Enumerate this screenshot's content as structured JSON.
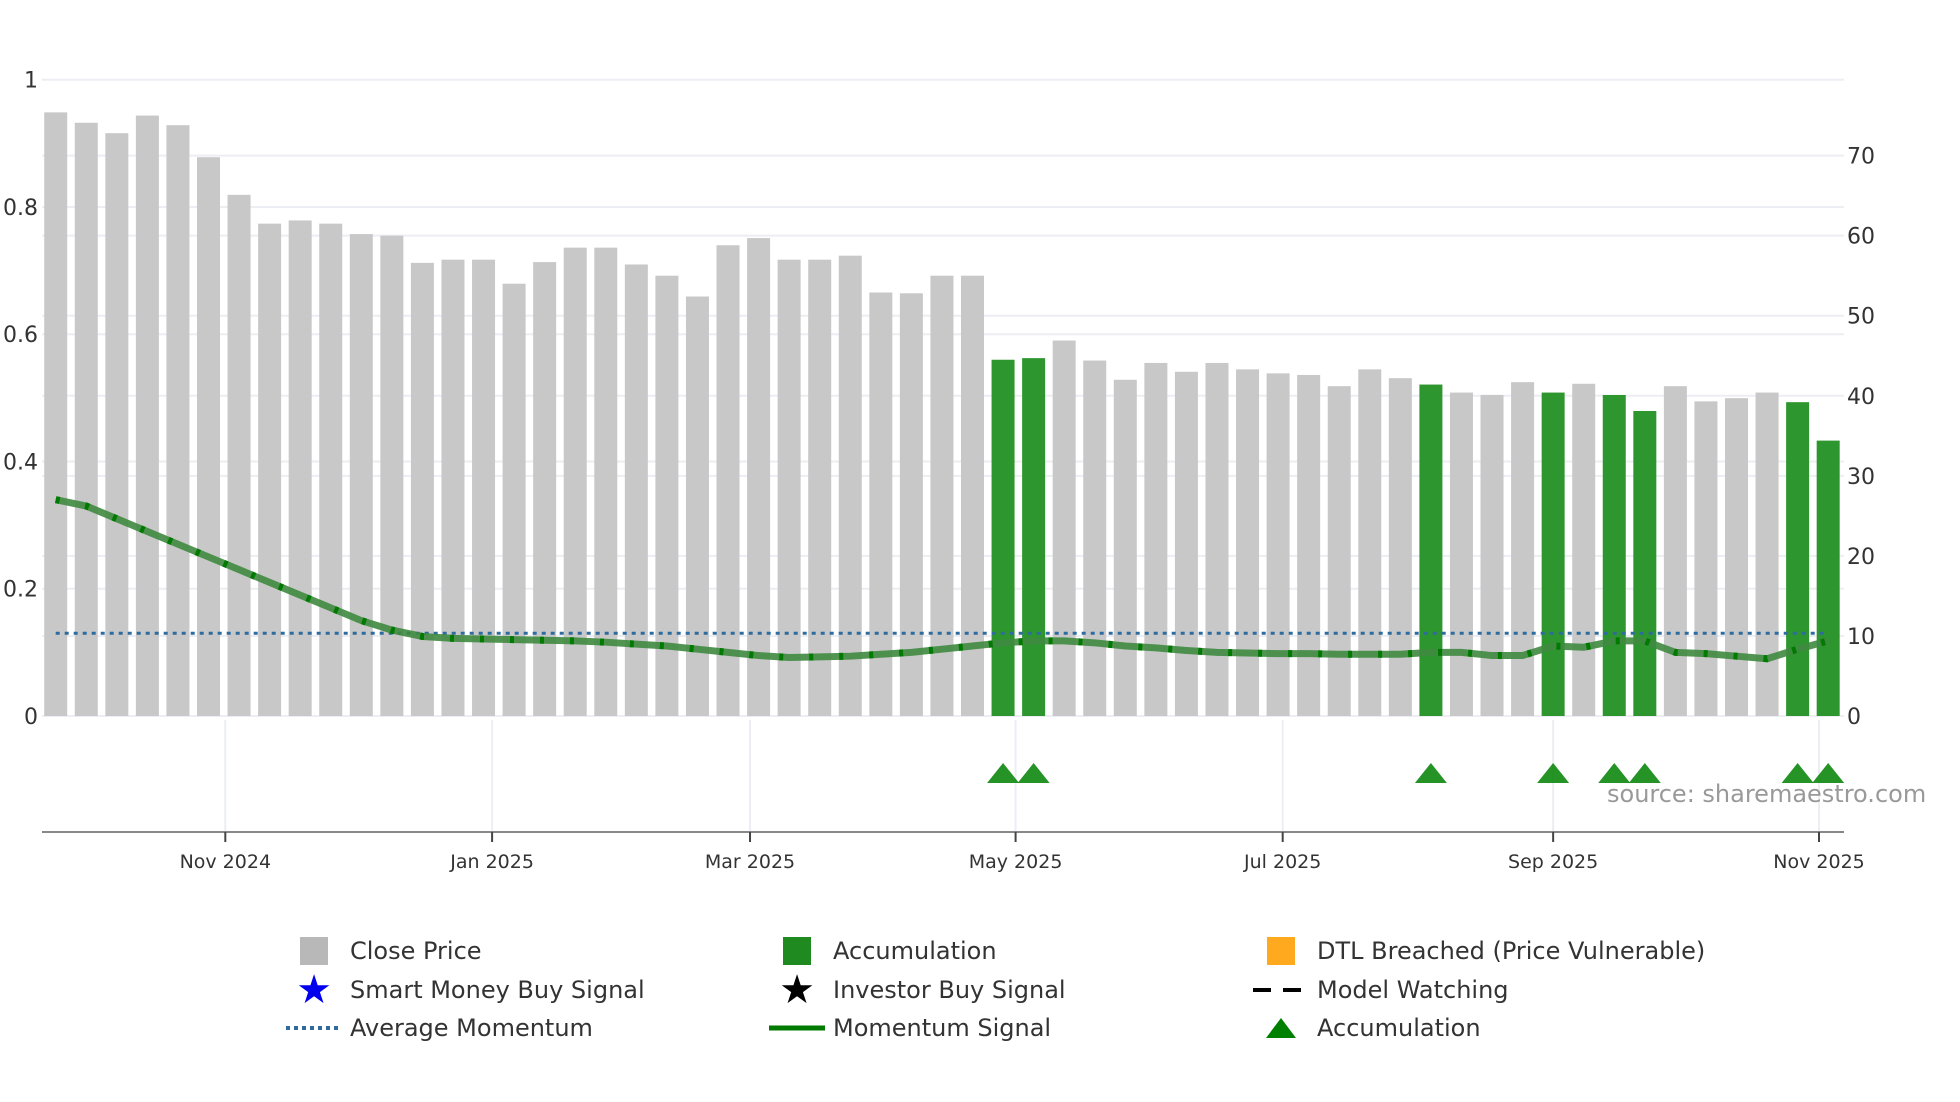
{
  "chart_data": {
    "type": "bar",
    "title": "",
    "source": "source: sharemaestro.com",
    "x_ticks": [
      {
        "label": "Nov 2024",
        "pos": 5.55
      },
      {
        "label": "Jan 2025",
        "pos": 14.28
      },
      {
        "label": "Mar 2025",
        "pos": 22.72
      },
      {
        "label": "May 2025",
        "pos": 31.41
      },
      {
        "label": "Jul 2025",
        "pos": 40.15
      },
      {
        "label": "Sep 2025",
        "pos": 49.0
      },
      {
        "label": "Nov 2025",
        "pos": 57.7
      }
    ],
    "y_left": {
      "ticks": [
        "0",
        "0.2",
        "0.4",
        "0.6",
        "0.8",
        "1"
      ],
      "range": [
        0,
        1
      ]
    },
    "y_right": {
      "ticks": [
        "0",
        "10",
        "20",
        "30",
        "40",
        "50",
        "60",
        "70"
      ],
      "range": [
        0,
        70
      ]
    },
    "close_price": [
      75.4,
      74.1,
      72.8,
      75.0,
      73.8,
      69.8,
      65.1,
      61.5,
      61.9,
      61.5,
      60.2,
      60.0,
      56.6,
      57.0,
      57.0,
      54.0,
      56.7,
      58.5,
      58.5,
      56.4,
      55.0,
      52.4,
      58.8,
      59.7,
      57.0,
      57.0,
      57.5,
      52.9,
      52.8,
      55.0,
      55.0,
      44.5,
      44.7,
      46.9,
      44.4,
      42.0,
      44.1,
      43.0,
      44.1,
      43.3,
      42.8,
      42.6,
      41.2,
      43.3,
      42.2,
      41.4,
      40.4,
      40.1,
      41.7,
      40.4,
      41.5,
      40.1,
      38.1,
      41.2,
      39.3,
      39.7,
      40.4,
      39.2,
      34.4
    ],
    "accumulation_bars": [
      31,
      32,
      45,
      49,
      51,
      52,
      57,
      58
    ],
    "accumulation_markers": [
      31,
      32,
      45,
      49,
      51,
      52,
      57,
      58
    ],
    "momentum_signal": [
      0.34,
      0.33,
      0.31,
      0.29,
      0.27,
      0.25,
      0.23,
      0.21,
      0.19,
      0.17,
      0.15,
      0.135,
      0.125,
      0.122,
      0.121,
      0.12,
      0.119,
      0.118,
      0.116,
      0.113,
      0.11,
      0.105,
      0.1,
      0.095,
      0.092,
      0.093,
      0.094,
      0.097,
      0.1,
      0.105,
      0.11,
      0.115,
      0.118,
      0.118,
      0.115,
      0.11,
      0.107,
      0.103,
      0.1,
      0.099,
      0.098,
      0.098,
      0.097,
      0.097,
      0.097,
      0.1,
      0.1,
      0.095,
      0.095,
      0.11,
      0.108,
      0.118,
      0.118,
      0.1,
      0.098,
      0.094,
      0.09,
      0.105,
      0.118
    ],
    "average_momentum": 0.13,
    "colors": {
      "close": "#c8c8c8",
      "accumulation": "#2e962e",
      "dtl": "#ffa500",
      "smart_money": "#0000ee",
      "investor": "#000000",
      "avg_momentum": "#2e6b9e",
      "momentum": "#3f8a40",
      "marker": "#008000"
    },
    "legend": [
      {
        "label": "Close Price",
        "icon": "gray-square"
      },
      {
        "label": "Accumulation",
        "icon": "green-square"
      },
      {
        "label": "DTL Breached (Price Vulnerable)",
        "icon": "orange-square"
      },
      {
        "label": "Smart Money Buy Signal",
        "icon": "blue-star"
      },
      {
        "label": "Investor Buy Signal",
        "icon": "black-star"
      },
      {
        "label": "Model Watching",
        "icon": "black-dash"
      },
      {
        "label": "Average Momentum",
        "icon": "blue-dotted-line"
      },
      {
        "label": "Momentum Signal",
        "icon": "green-line"
      },
      {
        "label": "Accumulation",
        "icon": "green-triangle"
      }
    ]
  }
}
